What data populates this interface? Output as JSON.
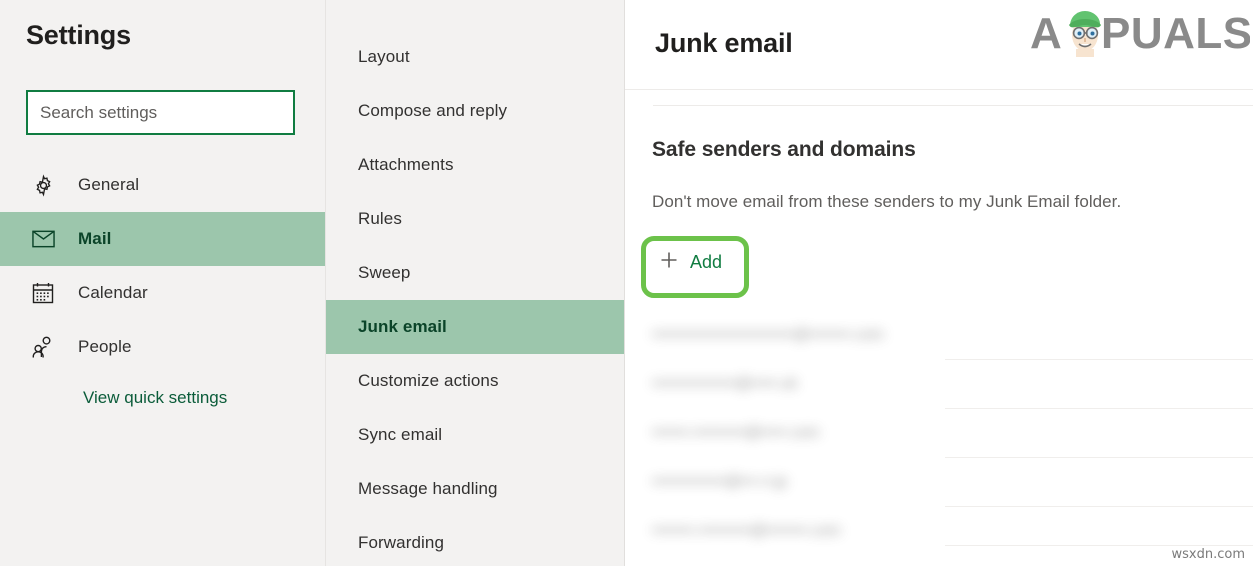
{
  "sidebar": {
    "title": "Settings",
    "search": {
      "placeholder": "Search settings",
      "value": "",
      "icon": "search-icon",
      "border_color": "#107c41"
    },
    "items": [
      {
        "label": "General",
        "icon": "gear-icon",
        "selected": false
      },
      {
        "label": "Mail",
        "icon": "envelope-icon",
        "selected": true
      },
      {
        "label": "Calendar",
        "icon": "calendar-icon",
        "selected": false
      },
      {
        "label": "People",
        "icon": "people-icon",
        "selected": false
      }
    ],
    "quick_settings_link": "View quick settings",
    "selected_color": "#9cc6ac",
    "background": "#f3f2f1"
  },
  "subnav": {
    "items": [
      {
        "label": "Layout",
        "selected": false
      },
      {
        "label": "Compose and reply",
        "selected": false
      },
      {
        "label": "Attachments",
        "selected": false
      },
      {
        "label": "Rules",
        "selected": false
      },
      {
        "label": "Sweep",
        "selected": false
      },
      {
        "label": "Junk email",
        "selected": true
      },
      {
        "label": "Customize actions",
        "selected": false
      },
      {
        "label": "Sync email",
        "selected": false
      },
      {
        "label": "Message handling",
        "selected": false
      },
      {
        "label": "Forwarding",
        "selected": false
      }
    ]
  },
  "main": {
    "page_title": "Junk email",
    "logo": {
      "text_before": "A",
      "text_after": "PUALS",
      "name": "appuals-logo",
      "color": "#8a8a8a",
      "cap_color": "#62c370"
    },
    "section": {
      "heading": "Safe senders and domains",
      "description": "Don't move email from these senders to my Junk Email folder."
    },
    "add_button": {
      "label": "Add",
      "icon": "plus-icon",
      "color": "#107c41",
      "highlight_color": "#6cc24a"
    },
    "senders": [
      {
        "value": "•••••••••••••••••••••••••••@••••••••.com",
        "redacted": true
      },
      {
        "value": "••••••••••••••••@•••••.uk",
        "redacted": true
      },
      {
        "value": "•••••••.••••••••••@•••••.com",
        "redacted": true
      },
      {
        "value": "••••••••••••••@•••.••.jp",
        "redacted": true
      },
      {
        "value": "••••••••.••••••••••@••••••••.com",
        "redacted": true
      }
    ]
  },
  "watermark": "wsxdn.com"
}
